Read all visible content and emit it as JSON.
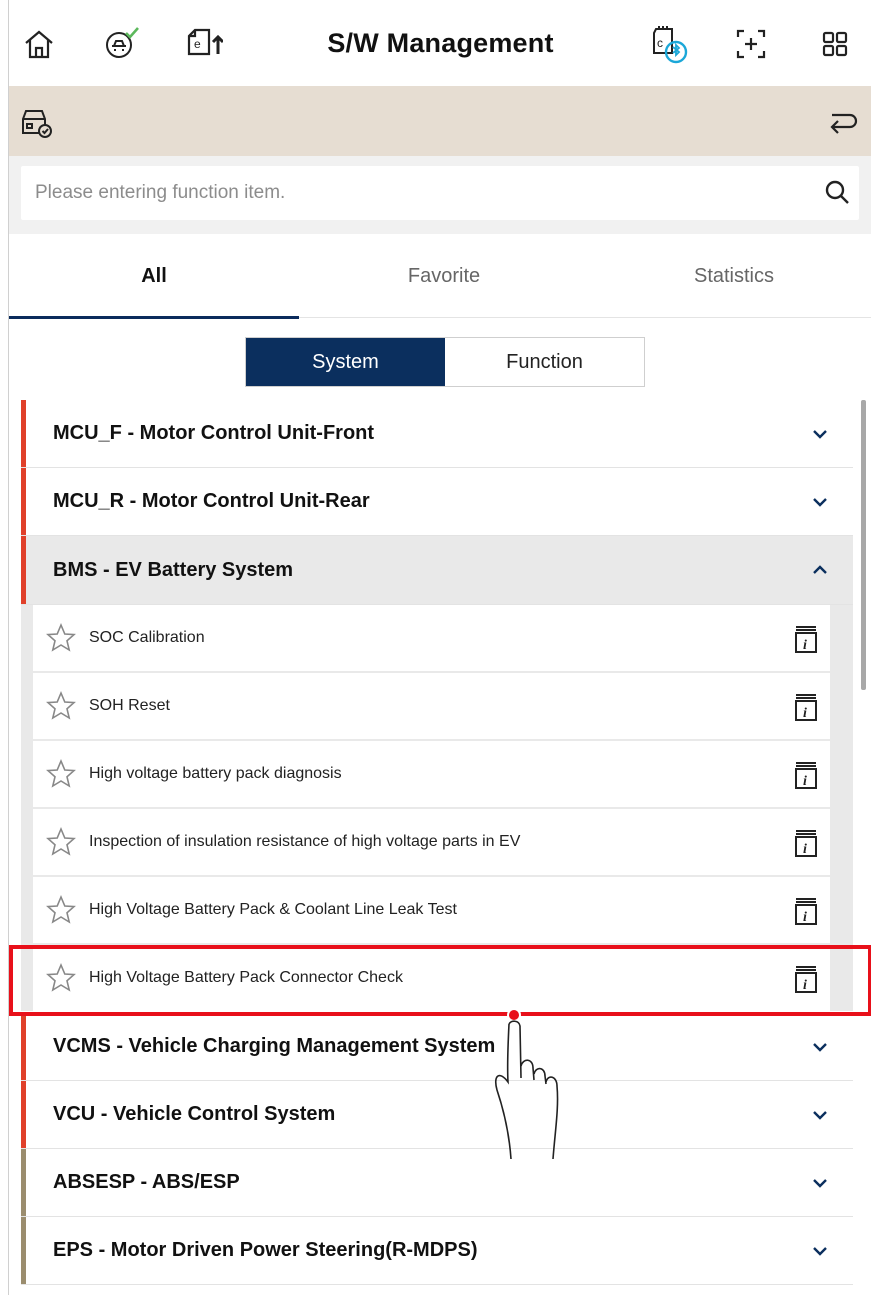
{
  "header": {
    "title": "S/W Management",
    "left_icons": [
      "home-icon",
      "vehicle-check-icon",
      "file-upload-icon"
    ],
    "right_icons": [
      "bluetooth-vci-icon",
      "screen-capture-icon",
      "grid-menu-icon"
    ]
  },
  "subbar": {
    "left_icon": "vehicle-status-icon",
    "right_icon": "back-arrow-icon"
  },
  "search": {
    "placeholder": "Please entering function item.",
    "value": ""
  },
  "tabs": [
    {
      "label": "All",
      "active": true
    },
    {
      "label": "Favorite",
      "active": false
    },
    {
      "label": "Statistics",
      "active": false
    }
  ],
  "segment": {
    "system_label": "System",
    "function_label": "Function",
    "selected": "System"
  },
  "groups_top": [
    {
      "label": "MCU_F - Motor Control Unit-Front",
      "open": false
    },
    {
      "label": "MCU_R - Motor Control Unit-Rear",
      "open": false
    }
  ],
  "open_group": {
    "label": "BMS - EV Battery System",
    "items": [
      "SOC Calibration",
      "SOH Reset",
      "High voltage battery pack diagnosis",
      "Inspection of insulation resistance of high voltage parts in EV",
      "High Voltage Battery Pack & Coolant Line Leak Test",
      "High Voltage Battery Pack Connector Check"
    ]
  },
  "groups_bottom": [
    {
      "label": "VCMS - Vehicle Charging Management System"
    },
    {
      "label": "VCU - Vehicle Control System"
    },
    {
      "label": "ABSESP - ABS/ESP"
    },
    {
      "label": "EPS - Motor Driven Power Steering(R-MDPS)"
    }
  ],
  "colors": {
    "accent": "#0b2f5e",
    "group_red": "#e0402a",
    "group_brown": "#9b8d6e",
    "highlight": "#e8101a"
  }
}
